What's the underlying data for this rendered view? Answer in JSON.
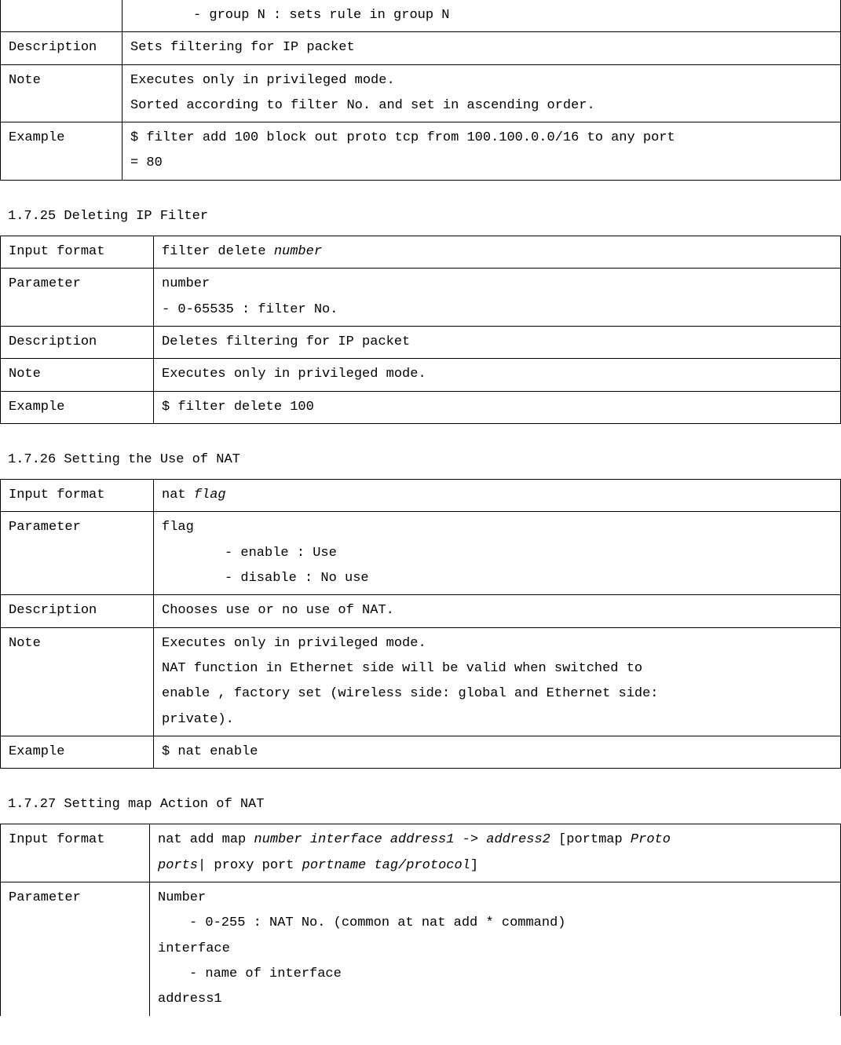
{
  "table0": {
    "row0": {
      "content": "- group N : sets rule in group N"
    },
    "desc": {
      "label": "Description",
      "content": "Sets filtering for IP packet"
    },
    "note": {
      "label": "Note",
      "line1": "Executes only in privileged mode.",
      "line2": "Sorted according to filter No. and set in ascending order."
    },
    "ex": {
      "label": "Example",
      "line1": "$ filter add 100 block out proto tcp from 100.100.0.0/16 to any port",
      "line2": "= 80"
    }
  },
  "sec25": {
    "title": "1.7.25 Deleting IP Filter",
    "fmt": {
      "label": "Input format",
      "content_a": "filter delete ",
      "content_b": "number"
    },
    "param": {
      "label": "Parameter",
      "line1": "number",
      "line2": "- 0-65535 : filter No."
    },
    "desc": {
      "label": "Description",
      "content": "Deletes filtering for IP packet"
    },
    "note": {
      "label": "Note",
      "content": "Executes only in privileged mode."
    },
    "ex": {
      "label": "Example",
      "content": "$ filter delete 100"
    }
  },
  "sec26": {
    "title": "1.7.26 Setting the Use of NAT",
    "fmt": {
      "label": "Input format",
      "content_a": "nat ",
      "content_b": "flag"
    },
    "param": {
      "label": "Parameter",
      "line1": "flag",
      "line2": "- enable : Use",
      "line3": "- disable : No use"
    },
    "desc": {
      "label": "Description",
      "content": "Chooses use or no use of NAT."
    },
    "note": {
      "label": "Note",
      "line1": "Executes only in privileged mode.",
      "line2": "NAT function in Ethernet side will be valid when switched to",
      "line3": "enable , factory set (wireless side: global and Ethernet side:",
      "line4": "private)."
    },
    "ex": {
      "label": "Example",
      "content": "$ nat enable"
    }
  },
  "sec27": {
    "title": "1.7.27 Setting map Action of NAT",
    "fmt": {
      "label": "Input format",
      "l1a": "nat add map ",
      "l1b": "number interface address1 -> address2 ",
      "l1c": "[portmap ",
      "l1d": "Proto",
      "l2a": "ports",
      "l2b": "| proxy port ",
      "l2c": "portname tag/protocol",
      "l2d": "]"
    },
    "param": {
      "label": "Parameter",
      "line1": "Number",
      "line2": "- 0-255 : NAT No. (common at nat add * command)",
      "line3": "interface",
      "line4": "- name of interface",
      "line5": "address1"
    }
  }
}
